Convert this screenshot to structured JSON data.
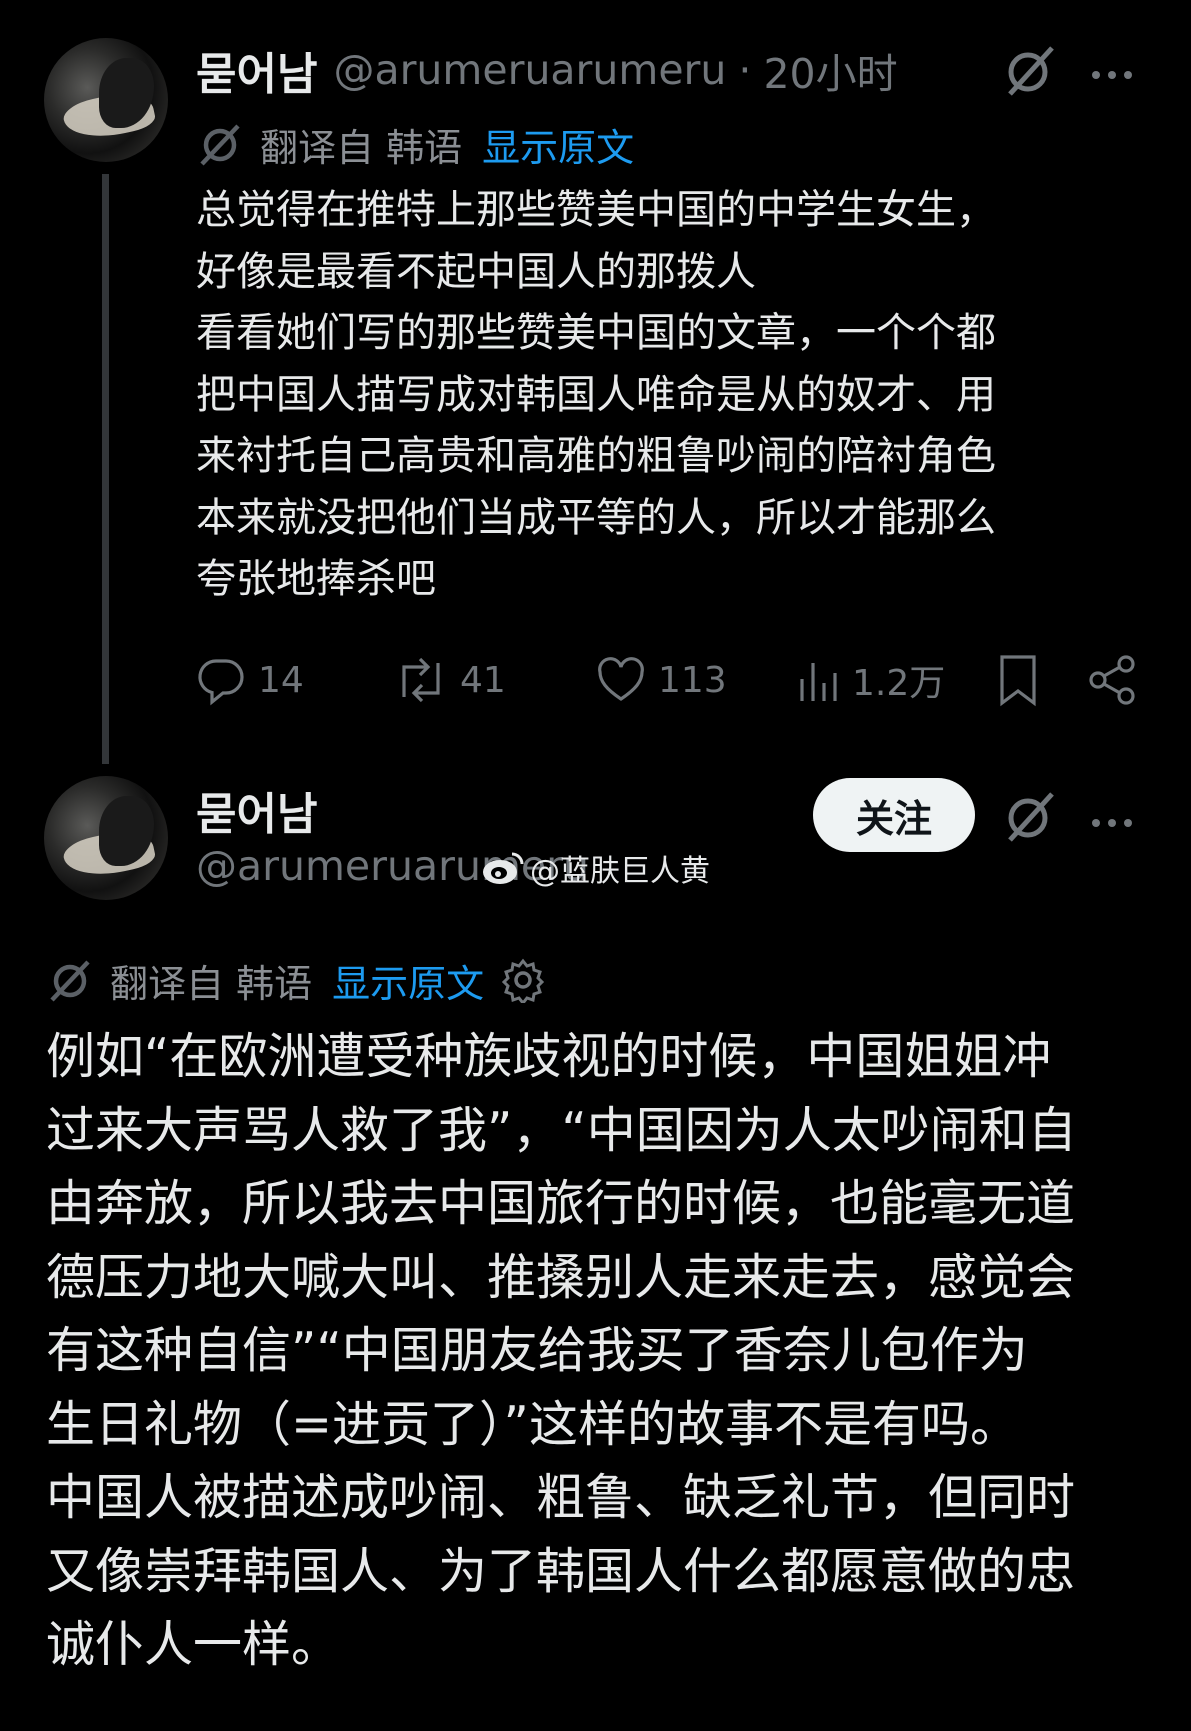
{
  "post1": {
    "display_name": "묻어남",
    "handle": "@arumeruarumeru",
    "separator": "·",
    "time": "20小时",
    "translation": {
      "label": "翻译自 韩语",
      "show_original": "显示原文"
    },
    "lines": [
      "总觉得在推特上那些赞美中国的中学生女生，",
      "好像是最看不起中国人的那拨人",
      "看看她们写的那些赞美中国的文章，一个个都",
      "把中国人描写成对韩国人唯命是从的奴才、用",
      "来衬托自己高贵和高雅的粗鲁吵闹的陪衬角色",
      "本来就没把他们当成平等的人，所以才能那么",
      "夸张地捧杀吧"
    ],
    "actions": {
      "replies": "14",
      "reposts": "41",
      "likes": "113",
      "views": "1.2万"
    }
  },
  "post2": {
    "display_name": "묻어남",
    "handle": "@arumeruarumeru",
    "follow_label": "关注",
    "watermark": "@蓝肤巨人黄",
    "translation": {
      "label": "翻译自 韩语",
      "show_original": "显示原文"
    },
    "lines": [
      "例如“在欧洲遭受种族歧视的时候，中国姐姐冲",
      "过来大声骂人救了我”，“中国因为人太吵闹和自",
      "由奔放，所以我去中国旅行的时候，也能毫无道",
      "德压力地大喊大叫、推搡别人走来走去，感觉会",
      "有这种自信”“中国朋友给我买了香奈儿包作为",
      "生日礼物（=进贡了）”这样的故事不是有吗。",
      "中国人被描述成吵闹、粗鲁、缺乏礼节，但同时",
      "又像崇拜韩国人、为了韩国人什么都愿意做的忠",
      "诚仆人一样。"
    ]
  },
  "colors": {
    "background": "#000000",
    "text": "#e7e9ea",
    "muted": "#71767b",
    "link": "#1d9bf0",
    "follow_bg": "#eff3f4"
  },
  "icons": [
    "grok-icon",
    "more-icon",
    "translate-icon",
    "reply-icon",
    "repost-icon",
    "like-icon",
    "views-icon",
    "bookmark-icon",
    "share-icon",
    "settings-gear-icon",
    "weibo-icon"
  ]
}
